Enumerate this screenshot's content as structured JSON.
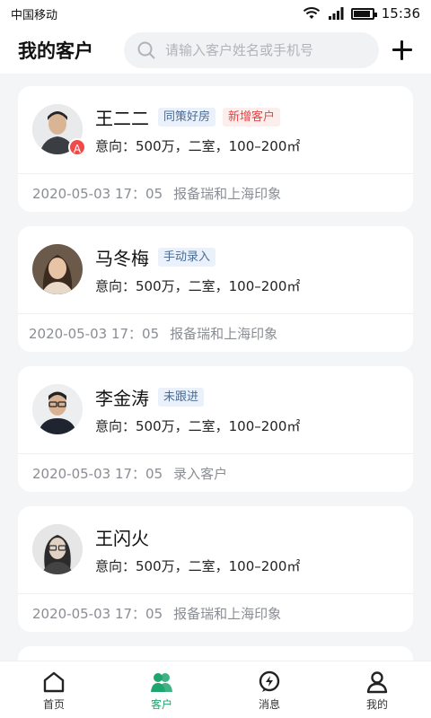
{
  "status": {
    "carrier": "中国移动",
    "time": "15:36"
  },
  "header": {
    "title": "我的客户",
    "search_placeholder": "请输入客户姓名或手机号"
  },
  "customers": [
    {
      "name": "王二二",
      "tags": [
        {
          "text": "同策好房",
          "style": "blue"
        },
        {
          "text": "新增客户",
          "style": "red"
        }
      ],
      "intent": "意向：500万，二室，100–200㎡",
      "date": "2020-05-03 17：05",
      "action": "报备瑞和上海印象",
      "badge": "A"
    },
    {
      "name": "马冬梅",
      "tags": [
        {
          "text": "手动录入",
          "style": "blue"
        }
      ],
      "intent": "意向：500万，二室，100–200㎡",
      "date": "2020-05-03 17：05",
      "action": "报备瑞和上海印象"
    },
    {
      "name": "李金涛",
      "tags": [
        {
          "text": "未跟进",
          "style": "blue"
        }
      ],
      "intent": "意向：500万，二室，100–200㎡",
      "date": "2020-05-03 17：05",
      "action": "录入客户"
    },
    {
      "name": "王闪火",
      "tags": [],
      "intent": "意向：500万，二室，100–200㎡",
      "date": "2020-05-03 17：05",
      "action": "报备瑞和上海印象"
    }
  ],
  "tabs": [
    {
      "label": "首页",
      "icon": "home-icon",
      "active": false
    },
    {
      "label": "客户",
      "icon": "customers-icon",
      "active": true
    },
    {
      "label": "消息",
      "icon": "message-icon",
      "active": false
    },
    {
      "label": "我的",
      "icon": "profile-icon",
      "active": false
    }
  ],
  "colors": {
    "accent": "#1fa56e",
    "tag_blue_bg": "#eaf1fb",
    "tag_red_bg": "#fdeeee",
    "badge": "#f04a4a"
  }
}
